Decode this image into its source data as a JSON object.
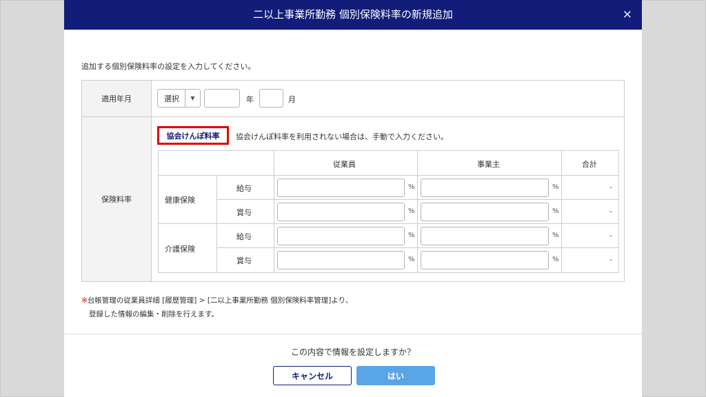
{
  "dialog": {
    "title": "二以上事業所勤務 個別保険料率の新規追加",
    "close": "×",
    "intro": "追加する個別保険料率の設定を入力してください。"
  },
  "row_apply": {
    "label": "適用年月",
    "select_value": "選択",
    "year_unit": "年",
    "month_unit": "月"
  },
  "row_rate": {
    "label": "保険料率",
    "kyokai_button": "協会けんぽ料率",
    "kyokai_note": "協会けんぽ料率を利用されない場合は、手動で入力ください。",
    "headers": {
      "employee": "従業員",
      "employer": "事業主",
      "total": "合計"
    },
    "categories": [
      {
        "name": "健康保険",
        "rows": [
          {
            "type": "給与",
            "total": "-"
          },
          {
            "type": "賞与",
            "total": "-"
          }
        ]
      },
      {
        "name": "介護保険",
        "rows": [
          {
            "type": "給与",
            "total": "-"
          },
          {
            "type": "賞与",
            "total": "-"
          }
        ]
      }
    ],
    "percent": "%"
  },
  "note": {
    "mark": "※",
    "line1": "台帳管理の従業員詳細 [履歴管理] > [二以上事業所勤務 個別保険料率管理]より、",
    "line2": "登録した情報の編集・削除を行えます。"
  },
  "footer": {
    "confirm": "この内容で情報を設定しますか？",
    "cancel": "キャンセル",
    "ok": "はい"
  }
}
